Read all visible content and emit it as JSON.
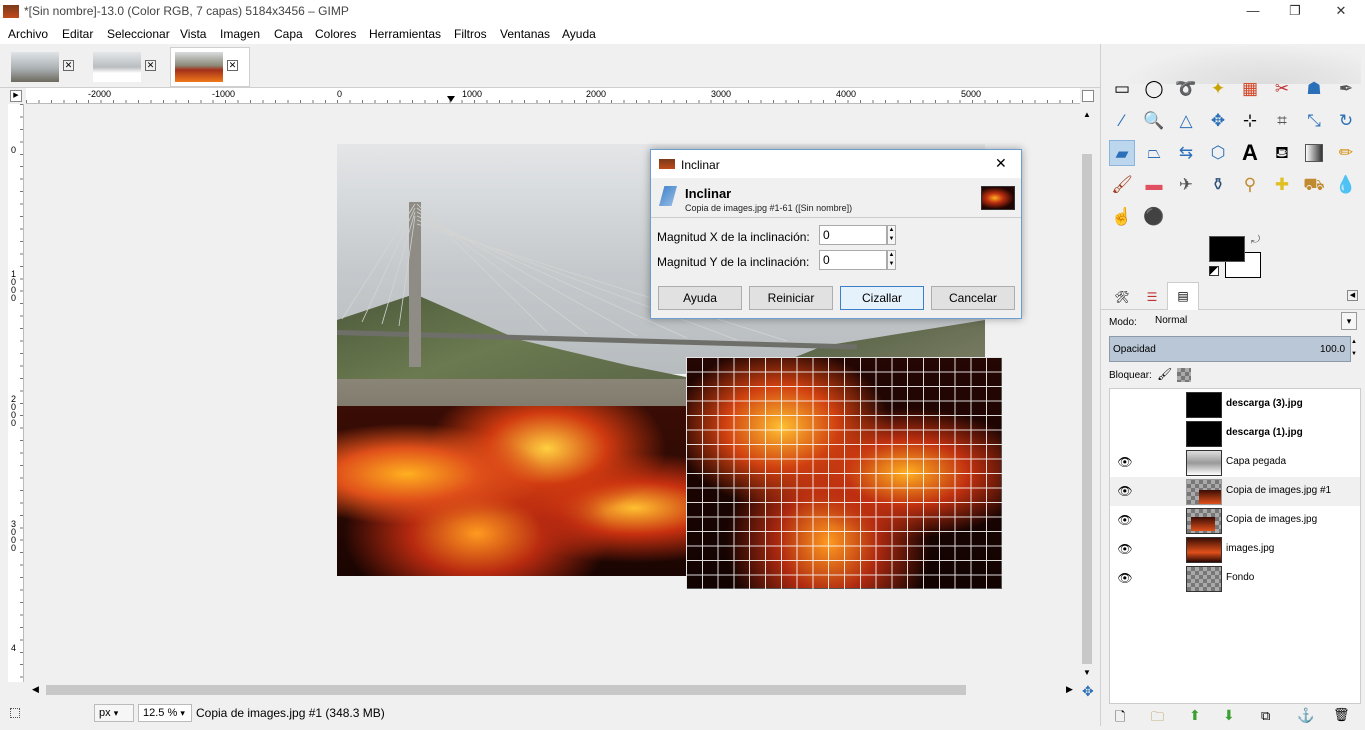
{
  "window": {
    "title": "*[Sin nombre]-13.0 (Color RGB, 7 capas) 5184x3456 – GIMP",
    "minimize": "—",
    "maximize": "❐",
    "close": "✕"
  },
  "menu": [
    "Archivo",
    "Editar",
    "Seleccionar",
    "Vista",
    "Imagen",
    "Capa",
    "Colores",
    "Herramientas",
    "Filtros",
    "Ventanas",
    "Ayuda"
  ],
  "tabs": [
    {
      "name": "image-tab-1",
      "close": "✕"
    },
    {
      "name": "image-tab-2",
      "close": "✕"
    },
    {
      "name": "image-tab-3",
      "close": "✕"
    }
  ],
  "rulers": {
    "horizontal": [
      "-2000",
      "-1000",
      "0",
      "1000",
      "2000",
      "3000",
      "4000",
      "5000"
    ],
    "vertical": [
      "0",
      "1000",
      "2000",
      "3000",
      "4"
    ]
  },
  "dialog": {
    "window_title": "Inclinar",
    "header": "Inclinar",
    "subtitle": "Copia de images.jpg #1-61 ([Sin nombre])",
    "label_x": "Magnitud X de la inclinación:",
    "value_x": "0",
    "label_y": "Magnitud Y de la inclinación:",
    "value_y": "0",
    "buttons": {
      "help": "Ayuda",
      "reset": "Reiniciar",
      "shear": "Cizallar",
      "cancel": "Cancelar"
    },
    "close": "✕"
  },
  "status": {
    "unit": "px",
    "zoom": "12.5 %",
    "message": "Copia de images.jpg #1 (348.3 MB)"
  },
  "layers_panel": {
    "mode_label": "Modo:",
    "mode_value": "Normal",
    "opacity_label": "Opacidad",
    "opacity_value": "100.0",
    "lock_label": "Bloquear:",
    "layers": [
      {
        "name": "descarga (3).jpg",
        "visible": false,
        "bold": true
      },
      {
        "name": "descarga (1).jpg",
        "visible": false,
        "bold": true
      },
      {
        "name": "Capa pegada",
        "visible": true,
        "bold": false
      },
      {
        "name": "Copia de images.jpg #1",
        "visible": true,
        "bold": false,
        "selected": true
      },
      {
        "name": "Copia de images.jpg",
        "visible": true,
        "bold": false
      },
      {
        "name": "images.jpg",
        "visible": true,
        "bold": false
      },
      {
        "name": "Fondo",
        "visible": true,
        "bold": false
      }
    ]
  },
  "tools": [
    "rect-select",
    "ellipse-select",
    "lasso",
    "fuzzy-select",
    "select-by-color",
    "scissors",
    "foreground-select",
    "paths",
    "color-picker",
    "zoom",
    "measure",
    "move",
    "align",
    "crop",
    "unified-transform",
    "rotate",
    "scale",
    "shear",
    "perspective",
    "flip",
    "cage",
    "text",
    "bucket-fill",
    "blend",
    "pencil",
    "paintbrush",
    "eraser",
    "airbrush",
    "ink",
    "clone",
    "heal",
    "perspective-clone",
    "blur",
    "smudge",
    "dodge"
  ],
  "colors": {
    "foreground": "#000000",
    "background": "#ffffff",
    "accent": "#3c7fc8"
  }
}
